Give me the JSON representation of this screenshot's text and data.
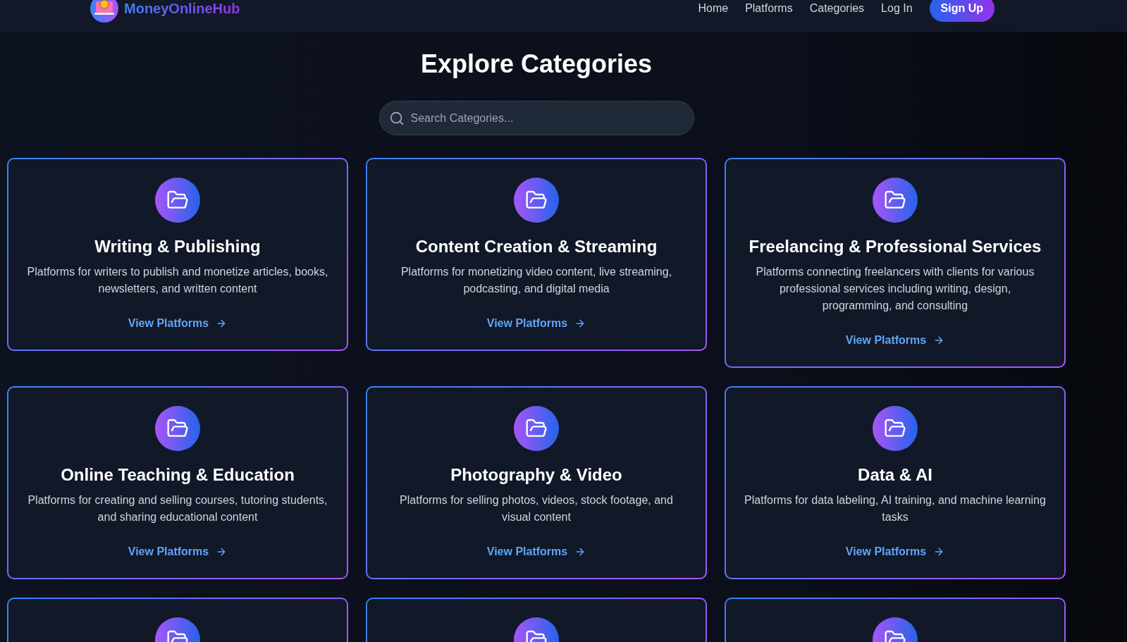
{
  "header": {
    "brand": "MoneyOnlineHub",
    "nav": [
      {
        "label": "Home",
        "kind": "link"
      },
      {
        "label": "Platforms",
        "kind": "link"
      },
      {
        "label": "Categories",
        "kind": "link"
      },
      {
        "label": "Log In",
        "kind": "link"
      },
      {
        "label": "Sign Up",
        "kind": "button"
      }
    ]
  },
  "page_title": "Explore Categories",
  "search": {
    "placeholder": "Search Categories..."
  },
  "cards": [
    {
      "kind": "full",
      "title": "Writing & Publishing",
      "description": "Platforms for writers to publish and monetize articles, books, newsletters, and written content",
      "link": "View Platforms"
    },
    {
      "kind": "full",
      "title": "Content Creation & Streaming",
      "description": "Platforms for monetizing video content, live streaming, podcasting, and digital media",
      "link": "View Platforms"
    },
    {
      "kind": "full",
      "title": "Freelancing & Professional Services",
      "description": "Platforms connecting freelancers with clients for various professional services including writing, design, programming, and consulting",
      "link": "View Platforms"
    },
    {
      "kind": "full",
      "title": "Online Teaching & Education",
      "description": "Platforms for creating and selling courses, tutoring students, and sharing educational content",
      "link": "View Platforms"
    },
    {
      "kind": "full",
      "title": "Photography & Video",
      "description": "Platforms for selling photos, videos, stock footage, and visual content",
      "link": "View Platforms"
    },
    {
      "kind": "full",
      "title": "Data & AI",
      "description": "Platforms for data labeling, AI training, and machine learning tasks",
      "link": "View Platforms"
    },
    {
      "kind": "partial"
    },
    {
      "kind": "partial"
    },
    {
      "kind": "partial"
    }
  ]
}
